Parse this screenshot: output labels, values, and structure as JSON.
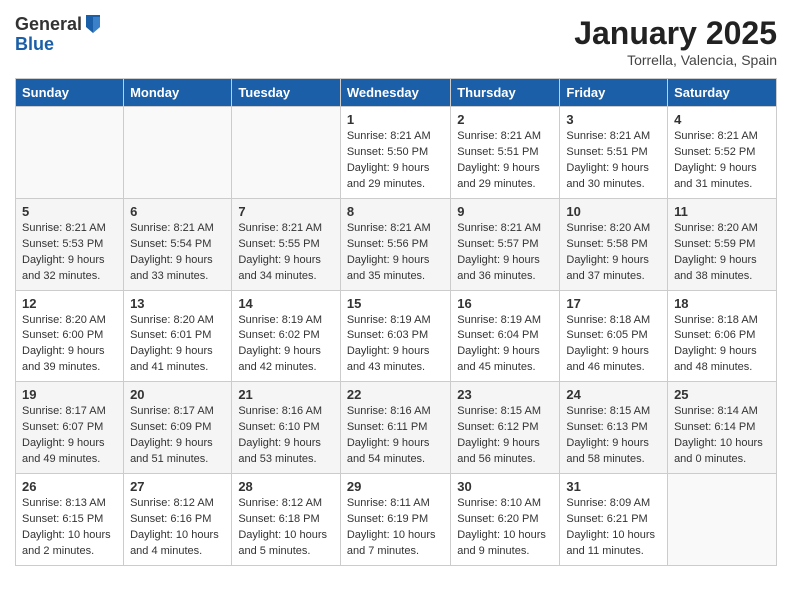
{
  "logo": {
    "general": "General",
    "blue": "Blue"
  },
  "title": "January 2025",
  "subtitle": "Torrella, Valencia, Spain",
  "days_header": [
    "Sunday",
    "Monday",
    "Tuesday",
    "Wednesday",
    "Thursday",
    "Friday",
    "Saturday"
  ],
  "weeks": [
    [
      {
        "num": "",
        "info": ""
      },
      {
        "num": "",
        "info": ""
      },
      {
        "num": "",
        "info": ""
      },
      {
        "num": "1",
        "info": "Sunrise: 8:21 AM\nSunset: 5:50 PM\nDaylight: 9 hours\nand 29 minutes."
      },
      {
        "num": "2",
        "info": "Sunrise: 8:21 AM\nSunset: 5:51 PM\nDaylight: 9 hours\nand 29 minutes."
      },
      {
        "num": "3",
        "info": "Sunrise: 8:21 AM\nSunset: 5:51 PM\nDaylight: 9 hours\nand 30 minutes."
      },
      {
        "num": "4",
        "info": "Sunrise: 8:21 AM\nSunset: 5:52 PM\nDaylight: 9 hours\nand 31 minutes."
      }
    ],
    [
      {
        "num": "5",
        "info": "Sunrise: 8:21 AM\nSunset: 5:53 PM\nDaylight: 9 hours\nand 32 minutes."
      },
      {
        "num": "6",
        "info": "Sunrise: 8:21 AM\nSunset: 5:54 PM\nDaylight: 9 hours\nand 33 minutes."
      },
      {
        "num": "7",
        "info": "Sunrise: 8:21 AM\nSunset: 5:55 PM\nDaylight: 9 hours\nand 34 minutes."
      },
      {
        "num": "8",
        "info": "Sunrise: 8:21 AM\nSunset: 5:56 PM\nDaylight: 9 hours\nand 35 minutes."
      },
      {
        "num": "9",
        "info": "Sunrise: 8:21 AM\nSunset: 5:57 PM\nDaylight: 9 hours\nand 36 minutes."
      },
      {
        "num": "10",
        "info": "Sunrise: 8:20 AM\nSunset: 5:58 PM\nDaylight: 9 hours\nand 37 minutes."
      },
      {
        "num": "11",
        "info": "Sunrise: 8:20 AM\nSunset: 5:59 PM\nDaylight: 9 hours\nand 38 minutes."
      }
    ],
    [
      {
        "num": "12",
        "info": "Sunrise: 8:20 AM\nSunset: 6:00 PM\nDaylight: 9 hours\nand 39 minutes."
      },
      {
        "num": "13",
        "info": "Sunrise: 8:20 AM\nSunset: 6:01 PM\nDaylight: 9 hours\nand 41 minutes."
      },
      {
        "num": "14",
        "info": "Sunrise: 8:19 AM\nSunset: 6:02 PM\nDaylight: 9 hours\nand 42 minutes."
      },
      {
        "num": "15",
        "info": "Sunrise: 8:19 AM\nSunset: 6:03 PM\nDaylight: 9 hours\nand 43 minutes."
      },
      {
        "num": "16",
        "info": "Sunrise: 8:19 AM\nSunset: 6:04 PM\nDaylight: 9 hours\nand 45 minutes."
      },
      {
        "num": "17",
        "info": "Sunrise: 8:18 AM\nSunset: 6:05 PM\nDaylight: 9 hours\nand 46 minutes."
      },
      {
        "num": "18",
        "info": "Sunrise: 8:18 AM\nSunset: 6:06 PM\nDaylight: 9 hours\nand 48 minutes."
      }
    ],
    [
      {
        "num": "19",
        "info": "Sunrise: 8:17 AM\nSunset: 6:07 PM\nDaylight: 9 hours\nand 49 minutes."
      },
      {
        "num": "20",
        "info": "Sunrise: 8:17 AM\nSunset: 6:09 PM\nDaylight: 9 hours\nand 51 minutes."
      },
      {
        "num": "21",
        "info": "Sunrise: 8:16 AM\nSunset: 6:10 PM\nDaylight: 9 hours\nand 53 minutes."
      },
      {
        "num": "22",
        "info": "Sunrise: 8:16 AM\nSunset: 6:11 PM\nDaylight: 9 hours\nand 54 minutes."
      },
      {
        "num": "23",
        "info": "Sunrise: 8:15 AM\nSunset: 6:12 PM\nDaylight: 9 hours\nand 56 minutes."
      },
      {
        "num": "24",
        "info": "Sunrise: 8:15 AM\nSunset: 6:13 PM\nDaylight: 9 hours\nand 58 minutes."
      },
      {
        "num": "25",
        "info": "Sunrise: 8:14 AM\nSunset: 6:14 PM\nDaylight: 10 hours\nand 0 minutes."
      }
    ],
    [
      {
        "num": "26",
        "info": "Sunrise: 8:13 AM\nSunset: 6:15 PM\nDaylight: 10 hours\nand 2 minutes."
      },
      {
        "num": "27",
        "info": "Sunrise: 8:12 AM\nSunset: 6:16 PM\nDaylight: 10 hours\nand 4 minutes."
      },
      {
        "num": "28",
        "info": "Sunrise: 8:12 AM\nSunset: 6:18 PM\nDaylight: 10 hours\nand 5 minutes."
      },
      {
        "num": "29",
        "info": "Sunrise: 8:11 AM\nSunset: 6:19 PM\nDaylight: 10 hours\nand 7 minutes."
      },
      {
        "num": "30",
        "info": "Sunrise: 8:10 AM\nSunset: 6:20 PM\nDaylight: 10 hours\nand 9 minutes."
      },
      {
        "num": "31",
        "info": "Sunrise: 8:09 AM\nSunset: 6:21 PM\nDaylight: 10 hours\nand 11 minutes."
      },
      {
        "num": "",
        "info": ""
      }
    ]
  ]
}
